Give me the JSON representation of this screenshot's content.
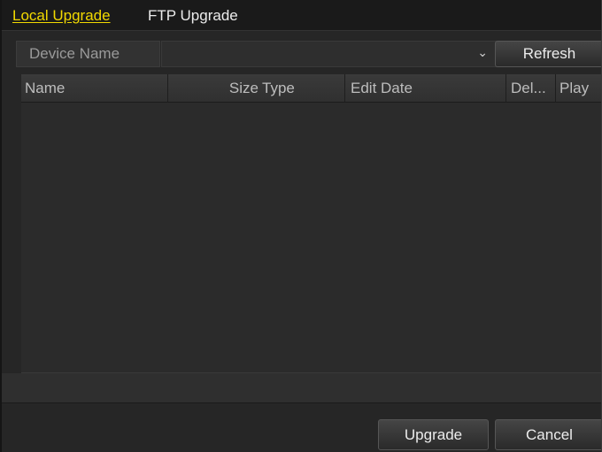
{
  "tabs": [
    {
      "label": "Local Upgrade",
      "active": true
    },
    {
      "label": "FTP Upgrade",
      "active": false
    }
  ],
  "device": {
    "label": "Device Name",
    "selected_value": "",
    "refresh_label": "Refresh"
  },
  "table": {
    "columns": [
      "Name",
      "Size",
      "Type",
      "Edit Date",
      "Del...",
      "Play"
    ],
    "rows": []
  },
  "actions": {
    "upgrade_label": "Upgrade",
    "cancel_label": "Cancel"
  },
  "colors": {
    "active_tab": "#f2d900",
    "background": "#262626"
  }
}
